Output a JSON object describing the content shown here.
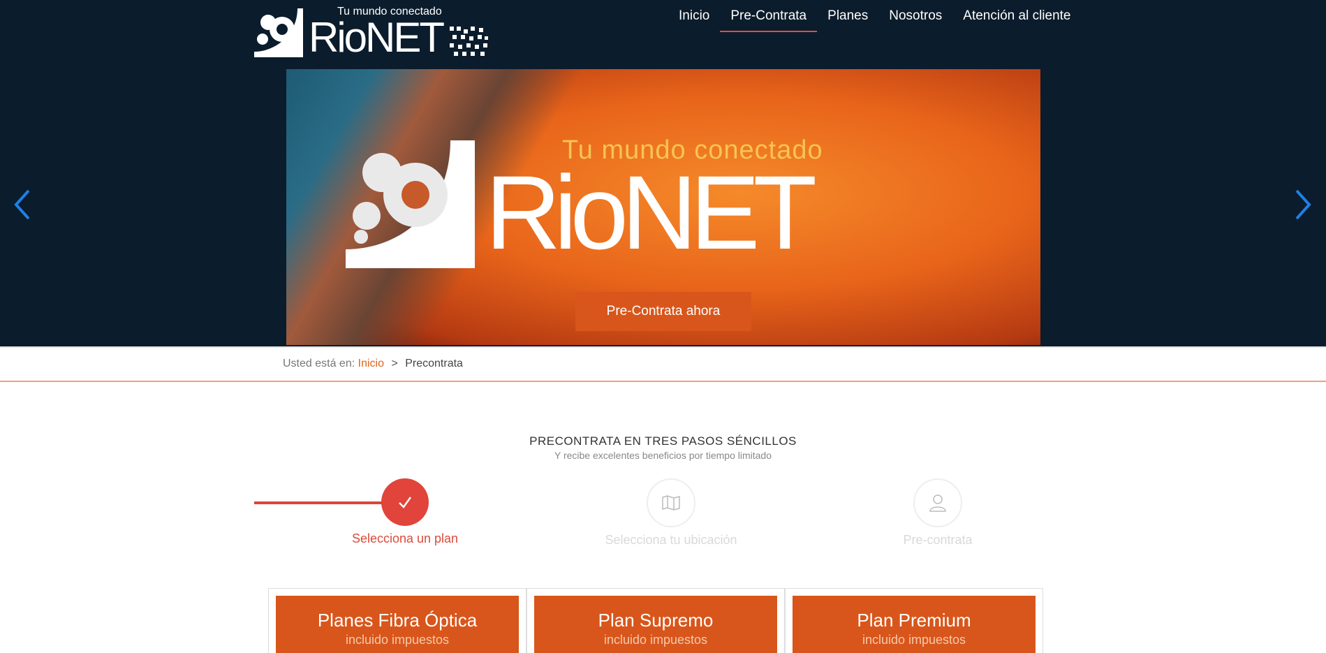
{
  "header": {
    "logo_tagline": "Tu mundo conectado",
    "logo_wordmark": "RioNET",
    "nav": [
      {
        "label": "Inicio",
        "active": false
      },
      {
        "label": "Pre-Contrata",
        "active": true
      },
      {
        "label": "Planes",
        "active": false
      },
      {
        "label": "Nosotros",
        "active": false
      },
      {
        "label": "Atención al cliente",
        "active": false
      }
    ]
  },
  "carousel": {
    "prev_icon": "chevron-left-icon",
    "next_icon": "chevron-right-icon",
    "banner_tagline": "Tu mundo conectado",
    "banner_wordmark": "RioNET",
    "cta_label": "Pre-Contrata ahora"
  },
  "breadcrumb": {
    "prefix": "Usted está en:",
    "home": "Inicio",
    "separator": ">",
    "current": "Precontrata"
  },
  "steps": {
    "title": "PRECONTRATA EN TRES PASOS SÉNCILLOS",
    "subtitle": "Y recibe excelentes beneficios por tiempo limitado",
    "items": [
      {
        "label": "Selecciona un plan",
        "icon": "check-icon",
        "done": true
      },
      {
        "label": "Selecciona tu ubicación",
        "icon": "map-icon",
        "done": false
      },
      {
        "label": "Pre-contrata",
        "icon": "user-icon",
        "done": false
      }
    ]
  },
  "plans": [
    {
      "name": "Planes Fibra Óptica",
      "note": "incluido impuestos"
    },
    {
      "name": "Plan Supremo",
      "note": "incluido impuestos"
    },
    {
      "name": "Plan Premium",
      "note": "incluido impuestos"
    }
  ],
  "colors": {
    "header_bg": "#0b1c2c",
    "accent": "#d8561b",
    "step_active": "#e0443a",
    "link": "#d9661f"
  }
}
